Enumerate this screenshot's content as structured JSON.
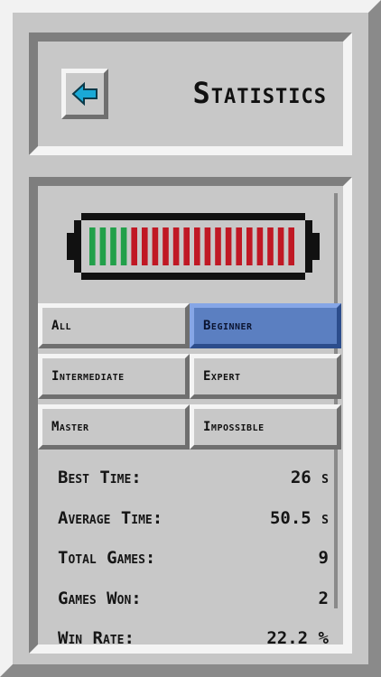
{
  "header": {
    "title": "Statistics",
    "back_icon": "arrow-left-icon",
    "back_icon_color": "#1aa9d6"
  },
  "battery": {
    "green_segments": 4,
    "red_segments": 16,
    "green_color": "#22a04a",
    "red_color": "#c01824"
  },
  "tabs": [
    {
      "label": "All",
      "active": false
    },
    {
      "label": "Beginner",
      "active": true
    },
    {
      "label": "Intermediate",
      "active": false
    },
    {
      "label": "Expert",
      "active": false
    },
    {
      "label": "Master",
      "active": false
    },
    {
      "label": "Impossible",
      "active": false
    }
  ],
  "stats": [
    {
      "label": "Best Time:",
      "value": "26 s"
    },
    {
      "label": "Average Time:",
      "value": "50.5 s"
    },
    {
      "label": "Total Games:",
      "value": "9"
    },
    {
      "label": "Games Won:",
      "value": "2"
    },
    {
      "label": "Win Rate:",
      "value": "22.2 %"
    }
  ],
  "colors": {
    "accent_tab": "#5b7fc1"
  }
}
